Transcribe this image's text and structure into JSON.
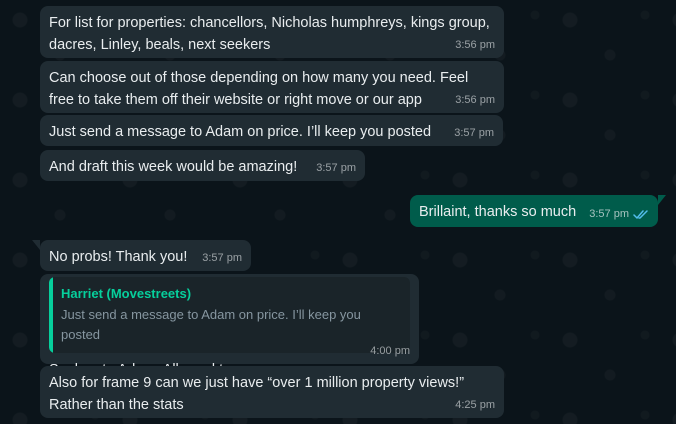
{
  "messages": [
    {
      "text": "For list for properties: chancellors, Nicholas humphreys, kings group, dacres, Linley, beals, next seekers",
      "time": "3:56 pm"
    },
    {
      "text": "Can choose out of those depending on how many you need. Feel free to take them off their website or right move or our app",
      "time": "3:56 pm"
    },
    {
      "text": "Just send a message to Adam on price. I’ll keep you posted",
      "time": "3:57 pm"
    },
    {
      "text": "And draft this week would be amazing!",
      "time": "3:57 pm"
    },
    {
      "text": "Brillaint, thanks so much",
      "time": "3:57 pm"
    },
    {
      "text": "No probs! Thank you!",
      "time": "3:57 pm"
    },
    {
      "quote_author": "Harriet (Movestreets)",
      "quote_text": "Just send a message to Adam on price. I’ll keep you posted",
      "text": "Spoken to Adam. All good to go",
      "time": "4:00 pm"
    },
    {
      "text": "Also for frame 9 can we just have “over 1 million property views!” Rather than the stats",
      "time": "4:25 pm"
    }
  ],
  "colors": {
    "background": "#0b141a",
    "incoming_bubble": "#202c33",
    "outgoing_bubble": "#005c4b",
    "quote_accent": "#06cf9c",
    "read_tick": "#53bdeb"
  },
  "icons": {
    "read_receipt": "double-check-icon"
  }
}
